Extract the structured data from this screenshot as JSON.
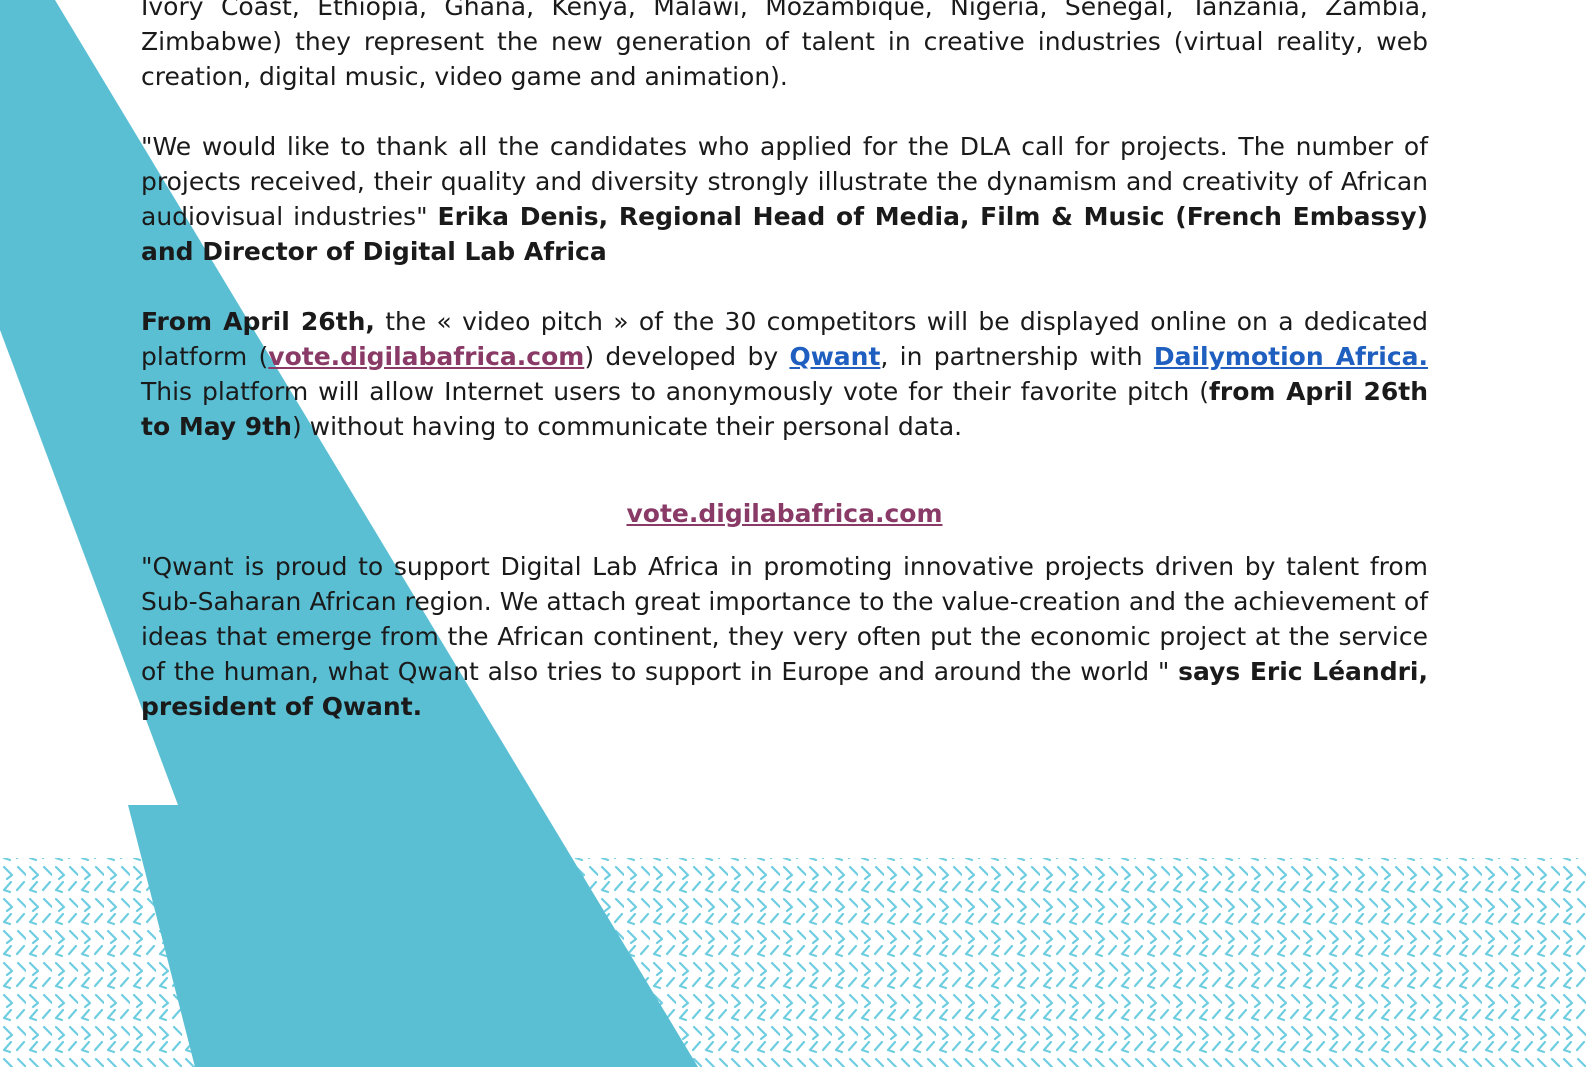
{
  "colors": {
    "accent_teal": "#5bbfd4",
    "pattern_teal": "#6fcde0",
    "link_blue": "#1e5fbf",
    "link_purple": "#8a3a66",
    "text": "#1a1a1a"
  },
  "paragraphs": {
    "intro": {
      "line1": "Ivory Coast, Ethiopia, Ghana, Kenya, Malawi, Mozambique, Nigeria, Senegal, Tanzania,",
      "rest": "Zambia, Zimbabwe) they represent the new generation of talent in creative industries (virtual reality, web creation, digital music, video game and animation)."
    },
    "quote1": {
      "text": "\"We would like to thank all the candidates who applied for the DLA call for projects. The number of projects received, their quality and diversity strongly illustrate the dynamism and creativity of African audiovisual industries\" ",
      "attribution": "Erika Denis, Regional Head of Media, Film & Music (French Embassy) and Director of Digital Lab Africa"
    },
    "vote": {
      "lead_bold": "From April 26th,",
      "t1": " the « video pitch » of the 30 competitors will be displayed online on a dedicated platform (",
      "link1": "vote.digilabafrica.com",
      "t2": ") developed by ",
      "link2": "Qwant",
      "t3": ", in partnership with ",
      "link3": "Dailymotion Africa. ",
      "t4": "This platform will allow Internet users to anonymously vote for their favorite pitch (",
      "dates_bold": "from April 26th to May 9th",
      "t5": ") without having to communicate their personal data."
    },
    "center_link": "vote.digilabafrica.com",
    "quote2": {
      "text": "\"Qwant is proud to support Digital Lab Africa in promoting innovative projects driven by talent from Sub-Saharan African region. We attach great importance to the value-creation and the achievement of ideas that emerge from the African continent, they very often put the economic project at the service of the human, what Qwant also tries to support in Europe and around the world \" ",
      "attribution": "says Eric Léandri, president of Qwant."
    }
  }
}
